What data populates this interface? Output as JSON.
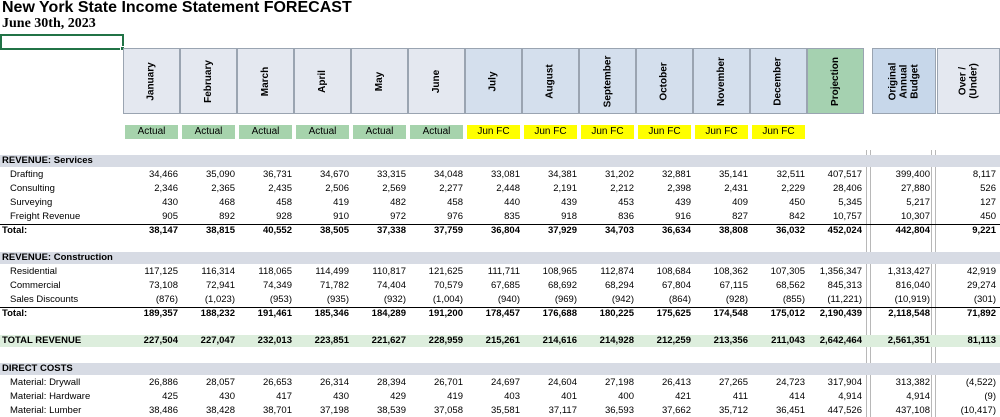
{
  "report": {
    "title": "New York State Income Statement FORECAST",
    "date": "June 30th, 2023"
  },
  "columns": [
    {
      "label": "January",
      "status": "Actual"
    },
    {
      "label": "February",
      "status": "Actual"
    },
    {
      "label": "March",
      "status": "Actual"
    },
    {
      "label": "April",
      "status": "Actual"
    },
    {
      "label": "May",
      "status": "Actual"
    },
    {
      "label": "June",
      "status": "Actual"
    },
    {
      "label": "July",
      "status": "Jun FC"
    },
    {
      "label": "August",
      "status": "Jun FC"
    },
    {
      "label": "September",
      "status": "Jun FC"
    },
    {
      "label": "October",
      "status": "Jun FC"
    },
    {
      "label": "November",
      "status": "Jun FC"
    },
    {
      "label": "December",
      "status": "Jun FC"
    },
    {
      "label": "Projection",
      "status": ""
    },
    {
      "label": "Original Annual Budget",
      "status": ""
    },
    {
      "label": "Over / (Under)",
      "status": ""
    }
  ],
  "colors": {
    "actual": "#a6d3ac",
    "forecast": "#ffff00",
    "projection_header": "#a5d1b0",
    "selection": "#217346"
  },
  "rows": [
    {
      "type": "section",
      "label": "REVENUE: Services"
    },
    {
      "type": "item",
      "label": "Drafting",
      "values": [
        "34,466",
        "35,090",
        "36,731",
        "34,670",
        "33,315",
        "34,048",
        "33,081",
        "34,381",
        "31,202",
        "32,881",
        "35,141",
        "32,511",
        "407,517",
        "399,400",
        "8,117"
      ]
    },
    {
      "type": "item",
      "label": "Consulting",
      "values": [
        "2,346",
        "2,365",
        "2,435",
        "2,506",
        "2,569",
        "2,277",
        "2,448",
        "2,191",
        "2,212",
        "2,398",
        "2,431",
        "2,229",
        "28,406",
        "27,880",
        "526"
      ]
    },
    {
      "type": "item",
      "label": "Surveying",
      "values": [
        "430",
        "468",
        "458",
        "419",
        "482",
        "458",
        "440",
        "439",
        "453",
        "439",
        "409",
        "450",
        "5,345",
        "5,217",
        "127"
      ]
    },
    {
      "type": "item",
      "label": "Freight Revenue",
      "values": [
        "905",
        "892",
        "928",
        "910",
        "972",
        "976",
        "835",
        "918",
        "836",
        "916",
        "827",
        "842",
        "10,757",
        "10,307",
        "450"
      ]
    },
    {
      "type": "total",
      "label": "Total:",
      "values": [
        "38,147",
        "38,815",
        "40,552",
        "38,505",
        "37,338",
        "37,759",
        "36,804",
        "37,929",
        "34,703",
        "36,634",
        "38,808",
        "36,032",
        "452,024",
        "442,804",
        "9,221"
      ]
    },
    {
      "type": "section",
      "label": "REVENUE: Construction"
    },
    {
      "type": "item",
      "label": "Residential",
      "values": [
        "117,125",
        "116,314",
        "118,065",
        "114,499",
        "110,817",
        "121,625",
        "111,711",
        "108,965",
        "112,874",
        "108,684",
        "108,362",
        "107,305",
        "1,356,347",
        "1,313,427",
        "42,919"
      ]
    },
    {
      "type": "item",
      "label": "Commercial",
      "values": [
        "73,108",
        "72,941",
        "74,349",
        "71,782",
        "74,404",
        "70,579",
        "67,685",
        "68,692",
        "68,294",
        "67,804",
        "67,115",
        "68,562",
        "845,313",
        "816,040",
        "29,274"
      ]
    },
    {
      "type": "item",
      "label": "Sales Discounts",
      "values": [
        "(876)",
        "(1,023)",
        "(953)",
        "(935)",
        "(932)",
        "(1,004)",
        "(940)",
        "(969)",
        "(942)",
        "(864)",
        "(928)",
        "(855)",
        "(11,221)",
        "(10,919)",
        "(301)"
      ]
    },
    {
      "type": "total",
      "label": "Total:",
      "values": [
        "189,357",
        "188,232",
        "191,461",
        "185,346",
        "184,289",
        "191,200",
        "178,457",
        "176,688",
        "180,225",
        "175,625",
        "174,548",
        "175,012",
        "2,190,439",
        "2,118,548",
        "71,892"
      ]
    },
    {
      "type": "grand",
      "label": "TOTAL REVENUE",
      "values": [
        "227,504",
        "227,047",
        "232,013",
        "223,851",
        "221,627",
        "228,959",
        "215,261",
        "214,616",
        "214,928",
        "212,259",
        "213,356",
        "211,043",
        "2,642,464",
        "2,561,351",
        "81,113"
      ]
    },
    {
      "type": "section",
      "label": "DIRECT COSTS"
    },
    {
      "type": "item",
      "label": "Material: Drywall",
      "values": [
        "26,886",
        "28,057",
        "26,653",
        "26,314",
        "28,394",
        "26,701",
        "24,697",
        "24,604",
        "27,198",
        "26,413",
        "27,265",
        "24,723",
        "317,904",
        "313,382",
        "(4,522)"
      ]
    },
    {
      "type": "item",
      "label": "Material: Hardware",
      "values": [
        "425",
        "430",
        "417",
        "430",
        "429",
        "419",
        "403",
        "401",
        "400",
        "421",
        "411",
        "414",
        "4,914",
        "4,914",
        "(9)"
      ]
    },
    {
      "type": "item",
      "label": "Material: Lumber",
      "values": [
        "38,486",
        "38,428",
        "38,701",
        "37,198",
        "38,539",
        "37,058",
        "35,581",
        "37,117",
        "36,593",
        "37,662",
        "35,712",
        "36,451",
        "447,526",
        "437,108",
        "(10,417)"
      ]
    }
  ]
}
